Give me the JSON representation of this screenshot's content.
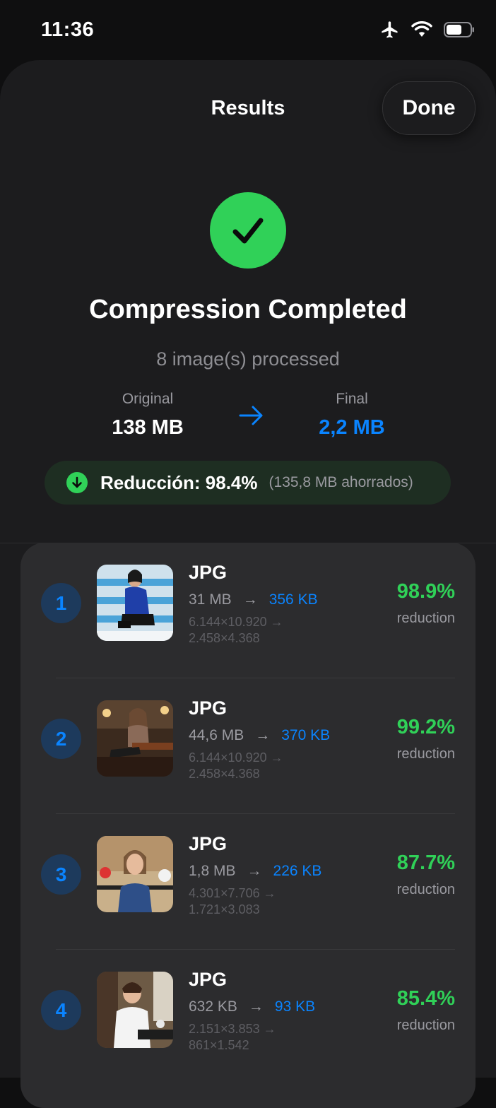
{
  "status": {
    "time": "11:36"
  },
  "header": {
    "title": "Results",
    "done_label": "Done"
  },
  "summary": {
    "headline": "Compression Completed",
    "processed": "8 image(s) processed",
    "original_label": "Original",
    "original_value": "138 MB",
    "final_label": "Final",
    "final_value": "2,2 MB",
    "reduction_text": "Reducción: 98.4%",
    "saved_text": "(135,8 MB ahorrados)"
  },
  "items": [
    {
      "index": "1",
      "format": "JPG",
      "original": "31 MB",
      "compressed": "356 KB",
      "dims_from": "6.144×10.920 →",
      "dims_to": "2.458×4.368",
      "percent": "98.9%",
      "percent_label": "reduction"
    },
    {
      "index": "2",
      "format": "JPG",
      "original": "44,6 MB",
      "compressed": "370 KB",
      "dims_from": "6.144×10.920 →",
      "dims_to": "2.458×4.368",
      "percent": "99.2%",
      "percent_label": "reduction"
    },
    {
      "index": "3",
      "format": "JPG",
      "original": "1,8 MB",
      "compressed": "226 KB",
      "dims_from": "4.301×7.706 →",
      "dims_to": "1.721×3.083",
      "percent": "87.7%",
      "percent_label": "reduction"
    },
    {
      "index": "4",
      "format": "JPG",
      "original": "632 KB",
      "compressed": "93 KB",
      "dims_from": "2.151×3.853 →",
      "dims_to": "861×1.542",
      "percent": "85.4%",
      "percent_label": "reduction"
    }
  ],
  "colors": {
    "accent": "#0a84ff",
    "success": "#30d158",
    "background": "#1c1c1e",
    "card": "#2c2c2e"
  }
}
